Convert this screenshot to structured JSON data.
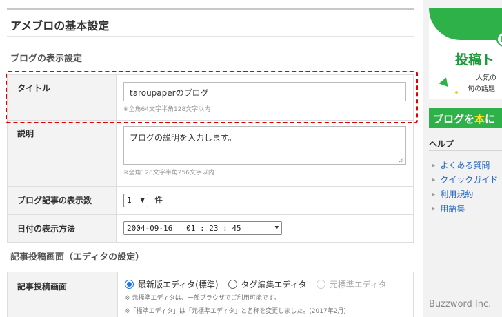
{
  "page": {
    "title": "アメブロの基本設定"
  },
  "blog_display": {
    "section_title": "ブログの表示設定",
    "title_row": {
      "label": "タイトル",
      "value": "taroupaperのブログ",
      "note": "※全角64文字半角128文字以内"
    },
    "description_row": {
      "label": "説明",
      "value": "ブログの説明を入力します。",
      "note": "※全角128文字半角256文字以内"
    },
    "count_row": {
      "label": "ブログ記事の表示数",
      "selected": "1",
      "unit": "件"
    },
    "date_row": {
      "label": "日付の表示方法",
      "selected": "2004-09-16   01 : 23 : 45"
    }
  },
  "editor": {
    "section_title": "記事投稿画面（エディタの設定）",
    "row": {
      "label": "記事投稿画面",
      "options": [
        {
          "label": "最新版エディタ(標準)",
          "checked": true,
          "disabled": false
        },
        {
          "label": "タグ編集エディタ",
          "checked": false,
          "disabled": false
        },
        {
          "label": "元標準エディタ",
          "checked": false,
          "disabled": true
        }
      ],
      "note1": "※ 元標準エディタは、一部ブラウザでご利用可能です。",
      "note2": "※「標準エディタ」は「元標準エディタ」と名称を変更しました。(2017年2月)"
    }
  },
  "sidebar": {
    "banner1": {
      "big_text": "投稿ト",
      "line1": "人気の",
      "line2": "旬の話題",
      "circle_glyph": "N"
    },
    "banner2": {
      "text_before": "ブログを",
      "highlight": "本",
      "text_after": "に"
    },
    "help": {
      "title": "ヘルプ",
      "items": [
        "よくある質問",
        "クイックガイド",
        "利用規約",
        "用語集"
      ]
    }
  },
  "credit": "Buzzword Inc.",
  "colors": {
    "accent_green": "#2fb14a",
    "highlight_red": "#e00000",
    "link_blue": "#2a6bc6",
    "radio_blue": "#1a73e8"
  }
}
